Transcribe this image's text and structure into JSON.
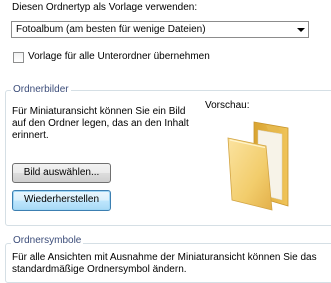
{
  "template_label": "Diesen Ordnertyp als Vorlage verwenden:",
  "template_select": {
    "value": "Fotoalbum (am besten für wenige Dateien)"
  },
  "subfolder_checkbox": {
    "label": "Vorlage für alle Unterordner übernehmen",
    "checked": false
  },
  "folder_pictures": {
    "title": "Ordnerbilder",
    "description": "Für Miniaturansicht können Sie ein Bild auf den Ordner legen, das an den Inhalt erinnert.",
    "preview_label": "Vorschau:",
    "choose_button": "Bild auswählen...",
    "restore_button": "Wiederherstellen"
  },
  "folder_icons": {
    "title": "Ordnersymbole",
    "description": "Für alle Ansichten mit Ausnahme der Miniaturansicht können Sie das standardmäßige Ordnersymbol ändern."
  },
  "icons": {
    "dropdown": "chevron-down-icon",
    "preview": "folder-icon"
  }
}
